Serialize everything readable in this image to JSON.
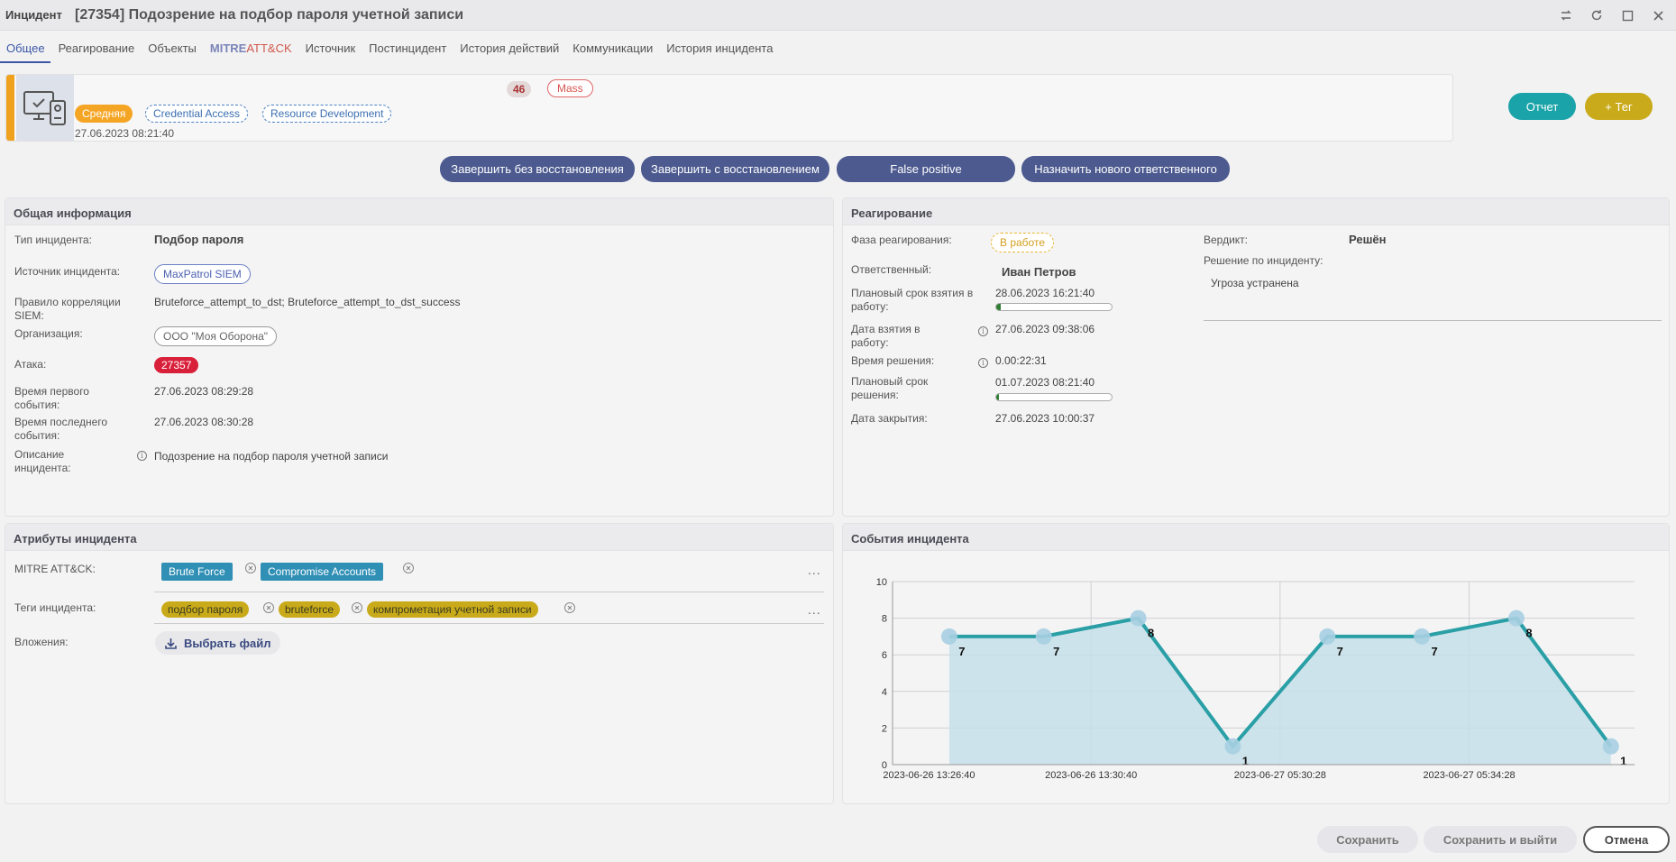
{
  "window": {
    "title": "Инцидент"
  },
  "tabs": [
    "Общее",
    "Реагирование",
    "Объекты",
    "Источник",
    "Постинцидент",
    "История действий",
    "Коммуникации",
    "История инцидента"
  ],
  "tab_mitre": {
    "part_a": "MITRE",
    "part_b": "ATT&CK"
  },
  "incident": {
    "title": "[27354] Подозрение на подбор пароля учетной записи",
    "count": "46",
    "mass": "Mass",
    "severity": "Средняя",
    "tactics": [
      "Credential Access",
      "Resource Development"
    ],
    "date": "27.06.2023 08:21:40"
  },
  "header_buttons": {
    "report": "Отчет",
    "tag": "+ Тег"
  },
  "actions": [
    "Завершить без восстановления",
    "Завершить с восстановлением",
    "False positive",
    "Назначить нового ответственного"
  ],
  "general": {
    "title": "Общая информация",
    "type_label": "Тип инцидента:",
    "type_value": "Подбор пароля",
    "source_label": "Источник инцидента:",
    "source_value": "MaxPatrol SIEM",
    "rule_label": "Правило корреляции SIEM:",
    "rule_value": "Bruteforce_attempt_to_dst; Bruteforce_attempt_to_dst_success",
    "org_label": "Организация:",
    "org_value": "ООО \"Моя Оборона\"",
    "attack_label": "Атака:",
    "attack_value": "27357",
    "first_label": "Время первого события:",
    "first_value": "27.06.2023 08:29:28",
    "last_label": "Время последнего события:",
    "last_value": "27.06.2023 08:30:28",
    "desc_label": "Описание инцидента:",
    "desc_value": "Подозрение на подбор пароля учетной записи"
  },
  "response": {
    "title": "Реагирование",
    "phase_label": "Фаза реагирования:",
    "phase_value": "В работе",
    "owner_label": "Ответственный:",
    "owner_value": "Иван Петров",
    "planned_take_label": "Плановый срок взятия в работу:",
    "planned_take_value": "28.06.2023 16:21:40",
    "planned_take_progress": 0.04,
    "taken_label": "Дата взятия в работу:",
    "taken_value": "27.06.2023 09:38:06",
    "solve_time_label": "Время решения:",
    "solve_time_value": "0.00:22:31",
    "planned_solve_label": "Плановый срок решения:",
    "planned_solve_value": "01.07.2023 08:21:40",
    "planned_solve_progress": 0.02,
    "close_label": "Дата закрытия:",
    "close_value": "27.06.2023 10:00:37",
    "verdict_label": "Вердикт:",
    "verdict_value": "Решён",
    "resolution_label": "Решение по инциденту:",
    "resolution_value": "Угроза устранена"
  },
  "attributes": {
    "title": "Атрибуты инцидента",
    "mitre_label": "MITRE ATT&CK:",
    "mitre_tags": [
      "Brute Force",
      "Compromise Accounts"
    ],
    "tags_label": "Теги инцидента:",
    "tags": [
      "подбор пароля",
      "bruteforce",
      "компрометация учетной записи"
    ],
    "attach_label": "Вложения:",
    "attach_button": "Выбрать файл",
    "ellipsis": "..."
  },
  "events": {
    "title": "События инцидента"
  },
  "chart_data": {
    "type": "area",
    "x": [
      "2023-06-26 13:26:40",
      "2023-06-26 13:27:40",
      "2023-06-26 13:30:40",
      "2023-06-26 13:31:40",
      "2023-06-27 05:30:28",
      "2023-06-27 05:31:28",
      "2023-06-27 05:34:28",
      "2023-06-27 05:35:28"
    ],
    "values": [
      7,
      7,
      8,
      1,
      7,
      7,
      8,
      1
    ],
    "xtick_labels": [
      "2023-06-26 13:26:40",
      "2023-06-26 13:30:40",
      "2023-06-27 05:30:28",
      "2023-06-27 05:34:28"
    ],
    "yticks": [
      0,
      2,
      4,
      6,
      8,
      10
    ],
    "ylim": [
      0,
      10
    ],
    "grid": true,
    "colors": {
      "line": "#2a9fa6",
      "area": "#c6dfe9",
      "marker": "#a7cfe2"
    }
  },
  "footer": {
    "save": "Сохранить",
    "save_exit": "Сохранить и выйти",
    "cancel": "Отмена"
  },
  "colors": {
    "primary": "#4c5a8f",
    "teal": "#1aa3a8",
    "gold": "#c8aa1a",
    "severity": "#f5a524"
  }
}
